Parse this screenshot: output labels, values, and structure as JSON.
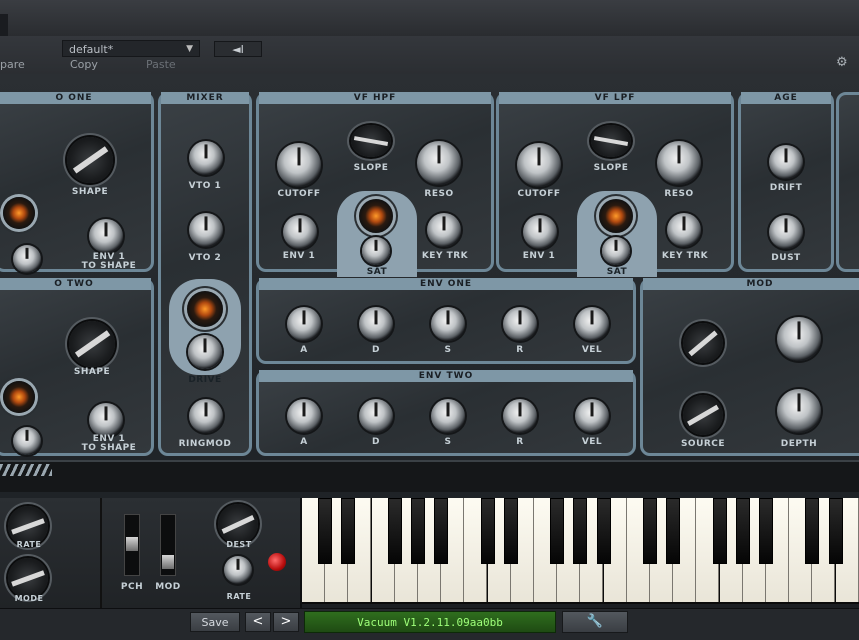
{
  "toolbar": {
    "preset_value": "default*",
    "dropdown_arrow": "▼",
    "nav_button": "◄I",
    "compare_label": "pare",
    "copy_label": "Copy",
    "paste_label": "Paste",
    "settings_icon": "gear-icon"
  },
  "panels": {
    "osc_one": {
      "title": "O ONE",
      "shape_label": "SHAPE",
      "env_label": "ENV 1\nTO SHAPE"
    },
    "osc_two": {
      "title": "O TWO",
      "shape_label": "SHAPE",
      "env_label": "ENV 1\nTO SHAPE"
    },
    "mixer": {
      "title": "MIXER",
      "vto1": "VTO 1",
      "vto2": "VTO 2",
      "drive": "DRIVE",
      "ringmod": "RINGMOD"
    },
    "vf_hpf": {
      "title": "VF HPF",
      "cutoff": "CUTOFF",
      "slope": "SLOPE",
      "reso": "RESO",
      "env1": "ENV 1",
      "sat": "SAT",
      "key_trk": "KEY TRK"
    },
    "vf_lpf": {
      "title": "VF LPF",
      "cutoff": "CUTOFF",
      "slope": "SLOPE",
      "reso": "RESO",
      "env1": "ENV 1",
      "sat": "SAT",
      "key_trk": "KEY TRK"
    },
    "age": {
      "title": "AGE",
      "drift": "DRIFT",
      "dust": "DUST"
    },
    "env_one": {
      "title": "ENV ONE",
      "labels": [
        "A",
        "D",
        "S",
        "R",
        "VEL"
      ]
    },
    "env_two": {
      "title": "ENV TWO",
      "labels": [
        "A",
        "D",
        "S",
        "R",
        "VEL"
      ]
    },
    "mod": {
      "title": "MOD",
      "source": "SOURCE",
      "depth": "DEPTH"
    }
  },
  "performance": {
    "rate1": "RATE",
    "mode": "MODE",
    "pch": "PCH",
    "mod": "MOD",
    "dest": "DEST",
    "rate2": "RATE"
  },
  "statusbar": {
    "save_label": "Save",
    "prev_label": "<",
    "next_label": ">",
    "version": "Vacuum V1.2.11.09aa0bb",
    "wrench_icon": "wrench-icon"
  }
}
